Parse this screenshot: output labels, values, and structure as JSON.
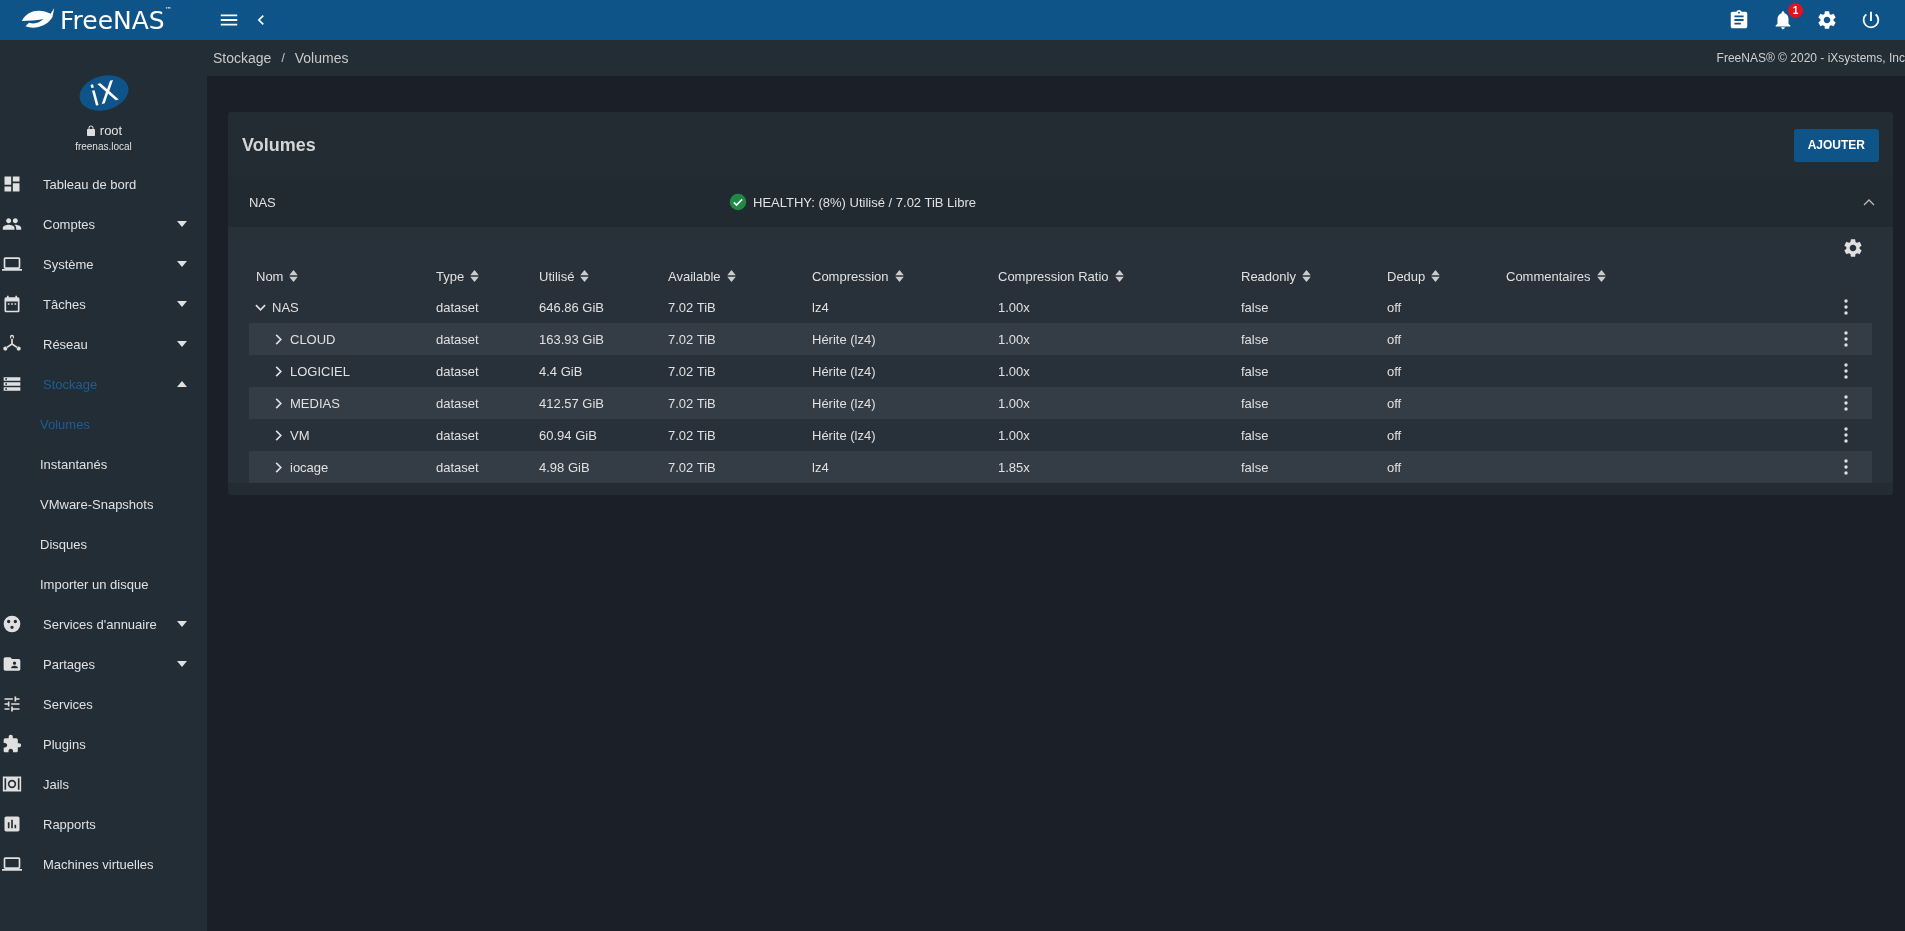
{
  "topbar": {
    "brand": "FreeNAS",
    "trademark": "™",
    "notification_count": "1"
  },
  "sidebar": {
    "logo_text": "iX",
    "user": "root",
    "host": "freenas.local",
    "items": [
      {
        "label": "Tableau de bord",
        "kind": "link",
        "selected": false
      },
      {
        "label": "Comptes",
        "kind": "group",
        "selected": false,
        "expanded": false
      },
      {
        "label": "Système",
        "kind": "group",
        "selected": false,
        "expanded": false
      },
      {
        "label": "Tâches",
        "kind": "group",
        "selected": false,
        "expanded": false
      },
      {
        "label": "Réseau",
        "kind": "group",
        "selected": false,
        "expanded": false
      },
      {
        "label": "Stockage",
        "kind": "group",
        "selected": true,
        "expanded": true,
        "children": [
          {
            "label": "Volumes",
            "selected": true
          },
          {
            "label": "Instantanés",
            "selected": false
          },
          {
            "label": "VMware-Snapshots",
            "selected": false
          },
          {
            "label": "Disques",
            "selected": false
          },
          {
            "label": "Importer un disque",
            "selected": false
          }
        ]
      },
      {
        "label": "Services d'annuaire",
        "kind": "group",
        "selected": false,
        "expanded": false
      },
      {
        "label": "Partages",
        "kind": "group",
        "selected": false,
        "expanded": false
      },
      {
        "label": "Services",
        "kind": "link",
        "selected": false
      },
      {
        "label": "Plugins",
        "kind": "link",
        "selected": false
      },
      {
        "label": "Jails",
        "kind": "link",
        "selected": false
      },
      {
        "label": "Rapports",
        "kind": "link",
        "selected": false
      },
      {
        "label": "Machines virtuelles",
        "kind": "link",
        "selected": false
      }
    ]
  },
  "breadcrumb": {
    "items": [
      "Stockage",
      "Volumes"
    ],
    "separator": "/",
    "copyright": "FreeNAS® © 2020 - iXsystems, Inc"
  },
  "card": {
    "title": "Volumes",
    "add_button": "AJOUTER",
    "pool": {
      "name": "NAS",
      "healthy": true,
      "status_text": "HEALTHY: (8%) Utilisé / 7.02 TiB Libre",
      "expanded": true
    },
    "table": {
      "columns": [
        "Nom",
        "Type",
        "Utilisé",
        "Available",
        "Compression",
        "Compression Ratio",
        "Readonly",
        "Dedup",
        "Commentaires"
      ],
      "rows": [
        {
          "name": "NAS",
          "type": "dataset",
          "used": "646.86 GiB",
          "available": "7.02 TiB",
          "compression": "lz4",
          "ratio": "1.00x",
          "readonly": "false",
          "dedup": "off",
          "expanded": true,
          "children": [
            {
              "name": "CLOUD",
              "type": "dataset",
              "used": "163.93 GiB",
              "available": "7.02 TiB",
              "compression": "Hérite (lz4)",
              "ratio": "1.00x",
              "readonly": "false",
              "dedup": "off",
              "expanded": false
            },
            {
              "name": "LOGICIEL",
              "type": "dataset",
              "used": "4.4 GiB",
              "available": "7.02 TiB",
              "compression": "Hérite (lz4)",
              "ratio": "1.00x",
              "readonly": "false",
              "dedup": "off",
              "expanded": false
            },
            {
              "name": "MEDIAS",
              "type": "dataset",
              "used": "412.57 GiB",
              "available": "7.02 TiB",
              "compression": "Hérite (lz4)",
              "ratio": "1.00x",
              "readonly": "false",
              "dedup": "off",
              "expanded": false
            },
            {
              "name": "VM",
              "type": "dataset",
              "used": "60.94 GiB",
              "available": "7.02 TiB",
              "compression": "Hérite (lz4)",
              "ratio": "1.00x",
              "readonly": "false",
              "dedup": "off",
              "expanded": false
            },
            {
              "name": "iocage",
              "type": "dataset",
              "used": "4.98 GiB",
              "available": "7.02 TiB",
              "compression": "lz4",
              "ratio": "1.85x",
              "readonly": "false",
              "dedup": "off",
              "expanded": false
            }
          ]
        }
      ]
    }
  }
}
